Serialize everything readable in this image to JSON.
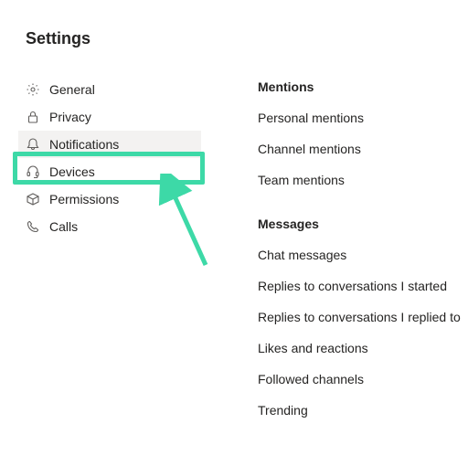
{
  "title": "Settings",
  "sidebar": {
    "items": [
      {
        "label": "General",
        "icon": "gear-icon"
      },
      {
        "label": "Privacy",
        "icon": "lock-icon"
      },
      {
        "label": "Notifications",
        "icon": "bell-icon",
        "selected": true
      },
      {
        "label": "Devices",
        "icon": "headset-icon"
      },
      {
        "label": "Permissions",
        "icon": "package-icon"
      },
      {
        "label": "Calls",
        "icon": "phone-icon"
      }
    ]
  },
  "sections": [
    {
      "header": "Mentions",
      "items": [
        "Personal mentions",
        "Channel mentions",
        "Team mentions"
      ]
    },
    {
      "header": "Messages",
      "items": [
        "Chat messages",
        "Replies to conversations I started",
        "Replies to conversations I replied to",
        "Likes and reactions",
        "Followed channels",
        "Trending"
      ]
    }
  ],
  "annotation": {
    "color": "#3dd9a7"
  }
}
